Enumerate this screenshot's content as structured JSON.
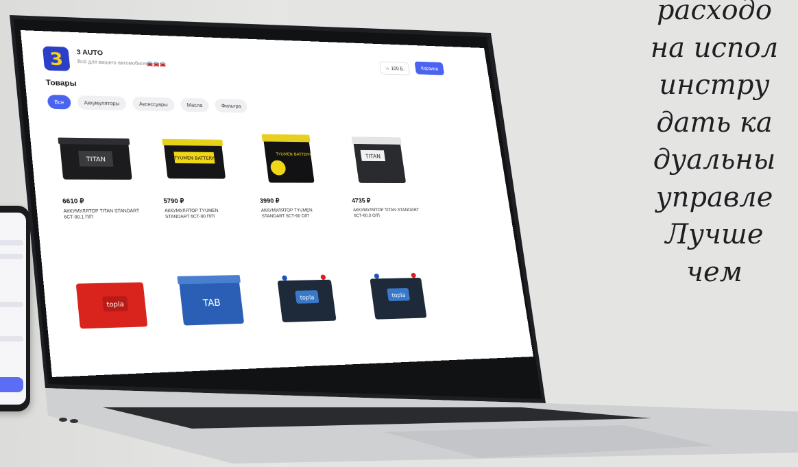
{
  "site": {
    "brand": "3 AUTO",
    "logo_char": "3",
    "tagline": "Всё для вашего автомобиля🚘🚘🚘",
    "favorites_label": "100 Б.",
    "cart_label": "Корзина"
  },
  "page_title": "Товары",
  "tabs": [
    {
      "label": "Все",
      "active": true
    },
    {
      "label": "Аккумуляторы",
      "active": false
    },
    {
      "label": "Аксессуары",
      "active": false
    },
    {
      "label": "Масла",
      "active": false
    },
    {
      "label": "Фильтра",
      "active": false
    }
  ],
  "products": [
    {
      "price": "6610 ₽",
      "name": "АККУМУЛЯТОР TITAN STANDART 6СТ-90.1 П/П",
      "body_color": "#1c1c1e",
      "label": "TITAN"
    },
    {
      "price": "5790 ₽",
      "name": "АККУМУЛЯТОР TYUMEN STANDART 6СТ-90 П/П",
      "body_color": "#161618",
      "label": "TYUMEN BATTERY"
    },
    {
      "price": "3990 ₽",
      "name": "АККУМУЛЯТОР TYUMEN STANDART 6СТ-60 О/П",
      "body_color": "#121214",
      "label": "TYUMEN BATTERY"
    },
    {
      "price": "4735 ₽",
      "name": "АККУМУЛЯТОР TITAN STANDART 6СТ-60.0 О/П",
      "body_color": "#2a2b2e",
      "label": "TITAN"
    },
    {
      "price": "",
      "name": "",
      "body_color": "#d9231d",
      "label": "topla"
    },
    {
      "price": "",
      "name": "",
      "body_color": "#2b5fb5",
      "label": "TAB"
    },
    {
      "price": "",
      "name": "",
      "body_color": "#1e2a3a",
      "label": "topla"
    },
    {
      "price": "",
      "name": "",
      "body_color": "#1e2a3a",
      "label": "topla"
    }
  ],
  "quote_lines": [
    "расходо",
    "на испол",
    "инстру",
    "дать ка",
    "дуальны",
    "управле",
    "Лучше",
    "чем"
  ],
  "colors": {
    "accent": "#4b64f0",
    "logo_bg": "#2b3fc9",
    "logo_fg": "#f6d21b"
  }
}
